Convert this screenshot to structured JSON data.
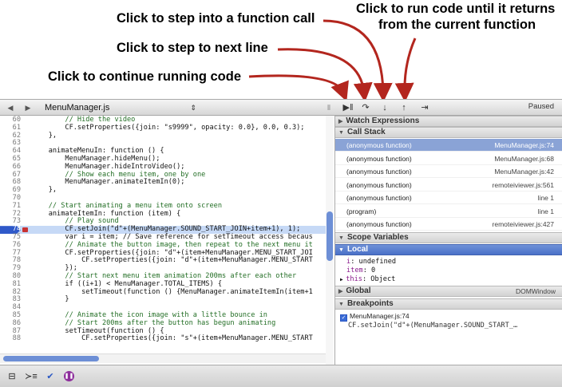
{
  "annotations": {
    "step_into": "Click to step into a function call",
    "run_until_return_line1": "Click to run code until it returns",
    "run_until_return_line2": "from the current function",
    "step_next": "Click to step to next line",
    "continue": "Click to continue running code"
  },
  "source_toolbar": {
    "back_icon": "left-triangle-icon",
    "forward_icon": "right-triangle-icon",
    "file_name": "MenuManager.js"
  },
  "debugger_toolbar": {
    "status": "Paused",
    "buttons": [
      "continue-icon",
      "step-over-icon",
      "step-into-icon",
      "step-out-icon",
      "deactivate-breakpoints-icon"
    ]
  },
  "code": [
    {
      "ln": "60",
      "text": "        // Hide the video",
      "kind": "comment"
    },
    {
      "ln": "61",
      "text": "        CF.setProperties({join: \"s9999\", opacity: 0.0}, 0.0, 0.3);"
    },
    {
      "ln": "62",
      "text": "    },"
    },
    {
      "ln": "63",
      "text": ""
    },
    {
      "ln": "64",
      "text": "    animateMenuIn: function () {"
    },
    {
      "ln": "65",
      "text": "        MenuManager.hideMenu();"
    },
    {
      "ln": "66",
      "text": "        MenuManager.hideIntroVideo();"
    },
    {
      "ln": "67",
      "text": "        // Show each menu item, one by one",
      "kind": "comment"
    },
    {
      "ln": "68",
      "text": "        MenuManager.animateItemIn(0);"
    },
    {
      "ln": "69",
      "text": "    },"
    },
    {
      "ln": "70",
      "text": ""
    },
    {
      "ln": "71",
      "text": "    // Start animating a menu item onto screen",
      "kind": "comment"
    },
    {
      "ln": "72",
      "text": "    animateItemIn: function (item) {"
    },
    {
      "ln": "73",
      "text": "        // Play sound",
      "kind": "comment"
    },
    {
      "ln": "74",
      "text": "        CF.setJoin(\"d\"+(MenuManager.SOUND_START_JOIN+item+1), 1);",
      "current": true
    },
    {
      "ln": "75",
      "text": "        var i = item; // Save reference for setTimeout access becaus"
    },
    {
      "ln": "76",
      "text": "        // Animate the button image, then repeat to the next menu it",
      "kind": "comment"
    },
    {
      "ln": "77",
      "text": "        CF.setProperties({join: \"d\"+(item+MenuManager.MENU_START_JOI"
    },
    {
      "ln": "78",
      "text": "            CF.setProperties({join: \"d\"+(item+MenuManager.MENU_START"
    },
    {
      "ln": "79",
      "text": "        });"
    },
    {
      "ln": "80",
      "text": "        // Start next menu item animation 200ms after each other",
      "kind": "comment"
    },
    {
      "ln": "81",
      "text": "        if ((i+1) < MenuManager.TOTAL_ITEMS) {"
    },
    {
      "ln": "82",
      "text": "            setTimeout(function () {MenuManager.animateItemIn(item+1"
    },
    {
      "ln": "83",
      "text": "        }"
    },
    {
      "ln": "84",
      "text": ""
    },
    {
      "ln": "85",
      "text": "        // Animate the icon image with a little bounce in",
      "kind": "comment"
    },
    {
      "ln": "86",
      "text": "        // Start 200ms after the button has begun animating",
      "kind": "comment"
    },
    {
      "ln": "87",
      "text": "        setTimeout(function () {"
    },
    {
      "ln": "88",
      "text": "            CF.setProperties({join: \"s\"+(item+MenuManager.MENU_START"
    }
  ],
  "watch_expressions": {
    "label": "Watch Expressions"
  },
  "call_stack": {
    "label": "Call Stack",
    "frames": [
      {
        "fn": "(anonymous function)",
        "loc": "MenuManager.js:74",
        "selected": true
      },
      {
        "fn": "(anonymous function)",
        "loc": "MenuManager.js:68"
      },
      {
        "fn": "(anonymous function)",
        "loc": "MenuManager.js:42"
      },
      {
        "fn": "(anonymous function)",
        "loc": "remoteiviewer.js:561"
      },
      {
        "fn": "(anonymous function)",
        "loc": "line 1"
      },
      {
        "fn": "(program)",
        "loc": "line 1"
      },
      {
        "fn": "(anonymous function)",
        "loc": "remoteiviewer.js:427"
      }
    ]
  },
  "scope_variables": {
    "label": "Scope Variables",
    "local_label": "Local",
    "vars": [
      {
        "name": "i",
        "value": ": undefined"
      },
      {
        "name": "item",
        "value": ": 0"
      },
      {
        "name": "this",
        "value": ": Object",
        "expandable": true
      }
    ],
    "global_label": "Global",
    "global_value": "DOMWindow"
  },
  "breakpoints": {
    "label": "Breakpoints",
    "items": [
      {
        "file": "MenuManager.js:74",
        "code": "CF.setJoin(\"d\"+(MenuManager.SOUND_START_…"
      }
    ]
  },
  "status_bar": {
    "buttons": [
      "console-icon",
      "scope-bar-icon",
      "checkmark-icon",
      "pause-on-exceptions-icon"
    ]
  }
}
